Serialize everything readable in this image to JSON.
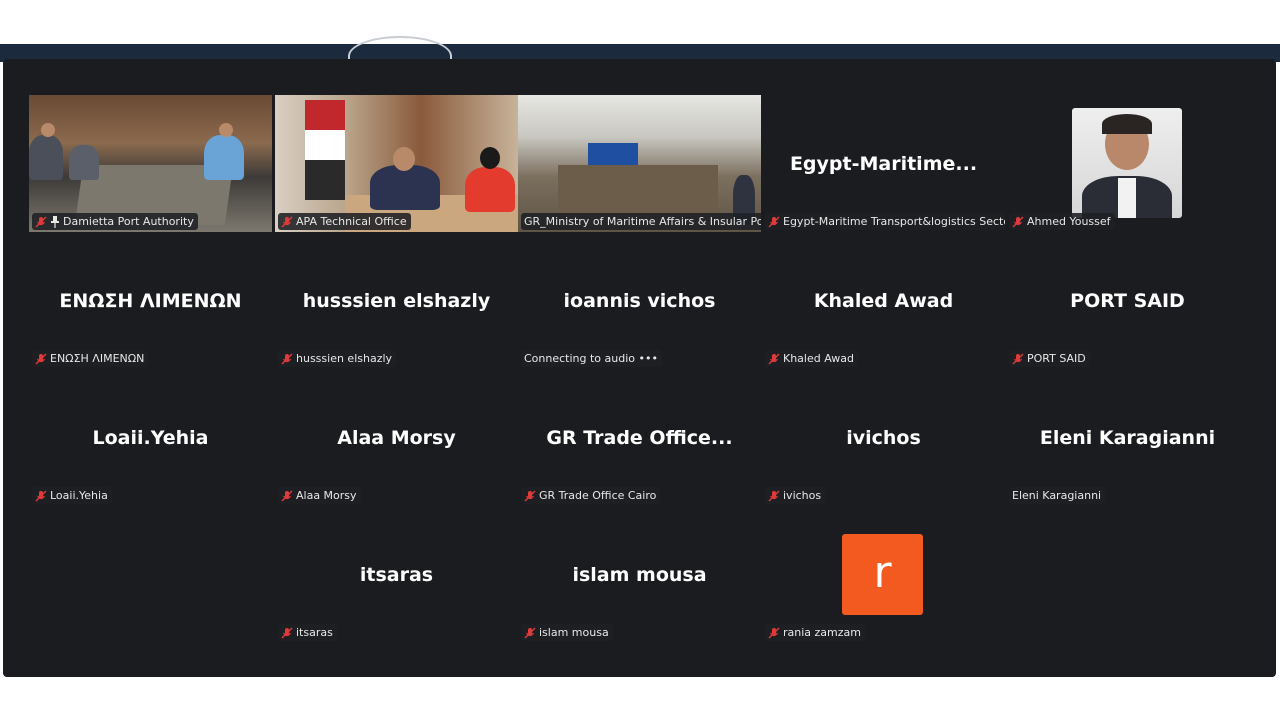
{
  "window": {
    "title": ""
  },
  "participants": [
    {
      "name": "Damietta Port Authority",
      "label": "Damietta Port Authority",
      "type": "video",
      "muted": true,
      "pinned": true,
      "active": true
    },
    {
      "name": "APA Technical Office",
      "label": "APA Technical Office",
      "type": "video",
      "muted": true
    },
    {
      "name": "GR_Ministry of Maritime Affairs & Insular Policy",
      "label": "GR_Ministry of Maritime Affairs & Insular Policy",
      "type": "video",
      "muted": false
    },
    {
      "name": "Egypt-Maritime...",
      "label": "Egypt-Maritime Transport&logistics Sector",
      "type": "name",
      "muted": true
    },
    {
      "name": "Ahmed Youssef",
      "label": "Ahmed Youssef",
      "type": "photo",
      "muted": true
    },
    {
      "name": "ΕΝΩΣΗ ΛΙΜΕΝΩΝ",
      "label": "ΕΝΩΣΗ ΛΙΜΕΝΩΝ",
      "type": "name",
      "muted": true
    },
    {
      "name": "husssien elshazly",
      "label": "husssien elshazly",
      "type": "name",
      "muted": true
    },
    {
      "name": "ioannis vichos",
      "label": "Connecting to audio •••",
      "type": "name",
      "muted": false
    },
    {
      "name": "Khaled Awad",
      "label": "Khaled Awad",
      "type": "name",
      "muted": true
    },
    {
      "name": "PORT SAID",
      "label": "PORT SAID",
      "type": "name",
      "muted": true
    },
    {
      "name": "Loaii.Yehia",
      "label": "Loaii.Yehia",
      "type": "name",
      "muted": true
    },
    {
      "name": "Alaa Morsy",
      "label": "Alaa Morsy",
      "type": "name",
      "muted": true
    },
    {
      "name": "GR Trade Office...",
      "label": "GR Trade Office Cairo",
      "type": "name",
      "muted": true
    },
    {
      "name": "ivichos",
      "label": "ivichos",
      "type": "name",
      "muted": true
    },
    {
      "name": "Eleni Karagianni",
      "label": "Eleni Karagianni",
      "type": "name",
      "muted": false
    },
    {
      "name": "itsaras",
      "label": "itsaras",
      "type": "name",
      "muted": true
    },
    {
      "name": "islam mousa",
      "label": "islam mousa",
      "type": "name",
      "muted": true
    },
    {
      "name": "r",
      "label": "rania zamzam",
      "type": "initial",
      "muted": true
    }
  ],
  "colors": {
    "background": "#1a1c1f",
    "active_border": "#22c55e",
    "muted_icon": "#e03a3a",
    "initial_avatar": "#f25a1f"
  }
}
